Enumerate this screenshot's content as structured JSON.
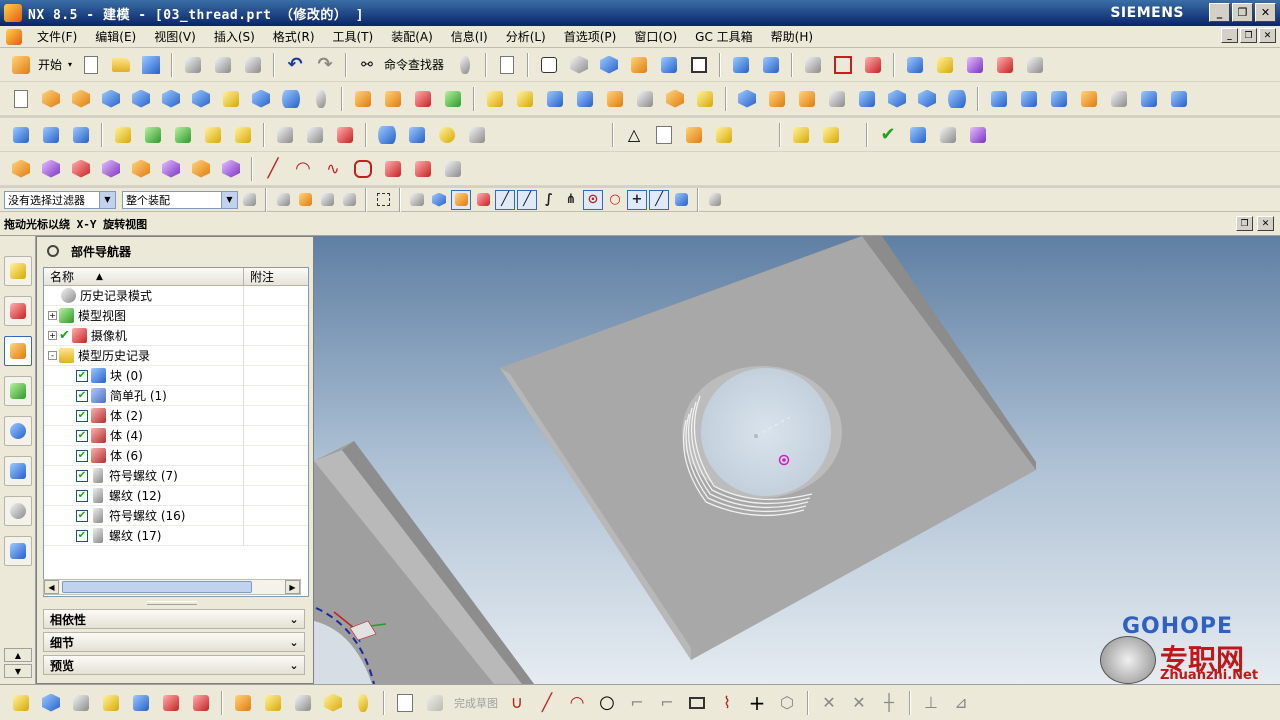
{
  "window": {
    "title": "NX 8.5 - 建模 - [03_thread.prt （修改的） ]",
    "brand": "SIEMENS",
    "controls": [
      "_",
      "❐",
      "✕"
    ]
  },
  "menu": {
    "items": [
      "文件(F)",
      "编辑(E)",
      "视图(V)",
      "插入(S)",
      "格式(R)",
      "工具(T)",
      "装配(A)",
      "信息(I)",
      "分析(L)",
      "首选项(P)",
      "窗口(O)",
      "GC 工具箱",
      "帮助(H)"
    ]
  },
  "toolbar_standard": {
    "start_label": "开始",
    "command_finder_label": "命令查找器"
  },
  "selection_bar": {
    "filter_value": "没有选择过滤器",
    "scope_value": "整个装配"
  },
  "prompt": {
    "text": "拖动光标以绕 X-Y 旋转视图"
  },
  "navigator": {
    "title": "部件导航器",
    "columns": {
      "name": "名称",
      "note": "附注"
    },
    "nodes": [
      {
        "label": "历史记录模式",
        "level": 0,
        "expander": "",
        "checked": false,
        "check_style": "none",
        "icon": "clock"
      },
      {
        "label": "模型视图",
        "level": 0,
        "expander": "+",
        "checked": false,
        "check_style": "none",
        "icon": "views"
      },
      {
        "label": "摄像机",
        "level": 0,
        "expander": "+",
        "checked": true,
        "check_style": "mark",
        "icon": "camera"
      },
      {
        "label": "模型历史记录",
        "level": 0,
        "expander": "-",
        "checked": false,
        "check_style": "none",
        "icon": "folder"
      },
      {
        "label": "块 (0)",
        "level": 1,
        "expander": "",
        "checked": true,
        "check_style": "box",
        "icon": "block"
      },
      {
        "label": "简单孔 (1)",
        "level": 1,
        "expander": "",
        "checked": true,
        "check_style": "box",
        "icon": "hole"
      },
      {
        "label": "体 (2)",
        "level": 1,
        "expander": "",
        "checked": true,
        "check_style": "box",
        "icon": "body"
      },
      {
        "label": "体 (4)",
        "level": 1,
        "expander": "",
        "checked": true,
        "check_style": "box",
        "icon": "body"
      },
      {
        "label": "体 (6)",
        "level": 1,
        "expander": "",
        "checked": true,
        "check_style": "box",
        "icon": "body"
      },
      {
        "label": "符号螺纹 (7)",
        "level": 1,
        "expander": "",
        "checked": true,
        "check_style": "box",
        "icon": "thread"
      },
      {
        "label": "螺纹 (12)",
        "level": 1,
        "expander": "",
        "checked": true,
        "check_style": "box",
        "icon": "thread"
      },
      {
        "label": "符号螺纹 (16)",
        "level": 1,
        "expander": "",
        "checked": true,
        "check_style": "box",
        "icon": "thread"
      },
      {
        "label": "螺纹 (17)",
        "level": 1,
        "expander": "",
        "checked": true,
        "check_style": "box",
        "icon": "thread"
      }
    ],
    "panels": [
      "相依性",
      "细节",
      "预览"
    ]
  },
  "bottom_toolbar": {
    "finish_sketch_label": "完成草图"
  },
  "watermark": {
    "brand": "GOHOPE",
    "cn": "专职网",
    "url": "Zhuanzhi.Net"
  },
  "colors": {
    "titlebar": "#0a246a",
    "menubar": "#ece9d8",
    "part_face": "#a8a8a8",
    "part_face_light": "#c8c8c8",
    "thread": "#e8e8e8",
    "accent": "#316ac5"
  },
  "icons": {
    "start": "start-icon",
    "command_finder": "binoculars-icon"
  }
}
